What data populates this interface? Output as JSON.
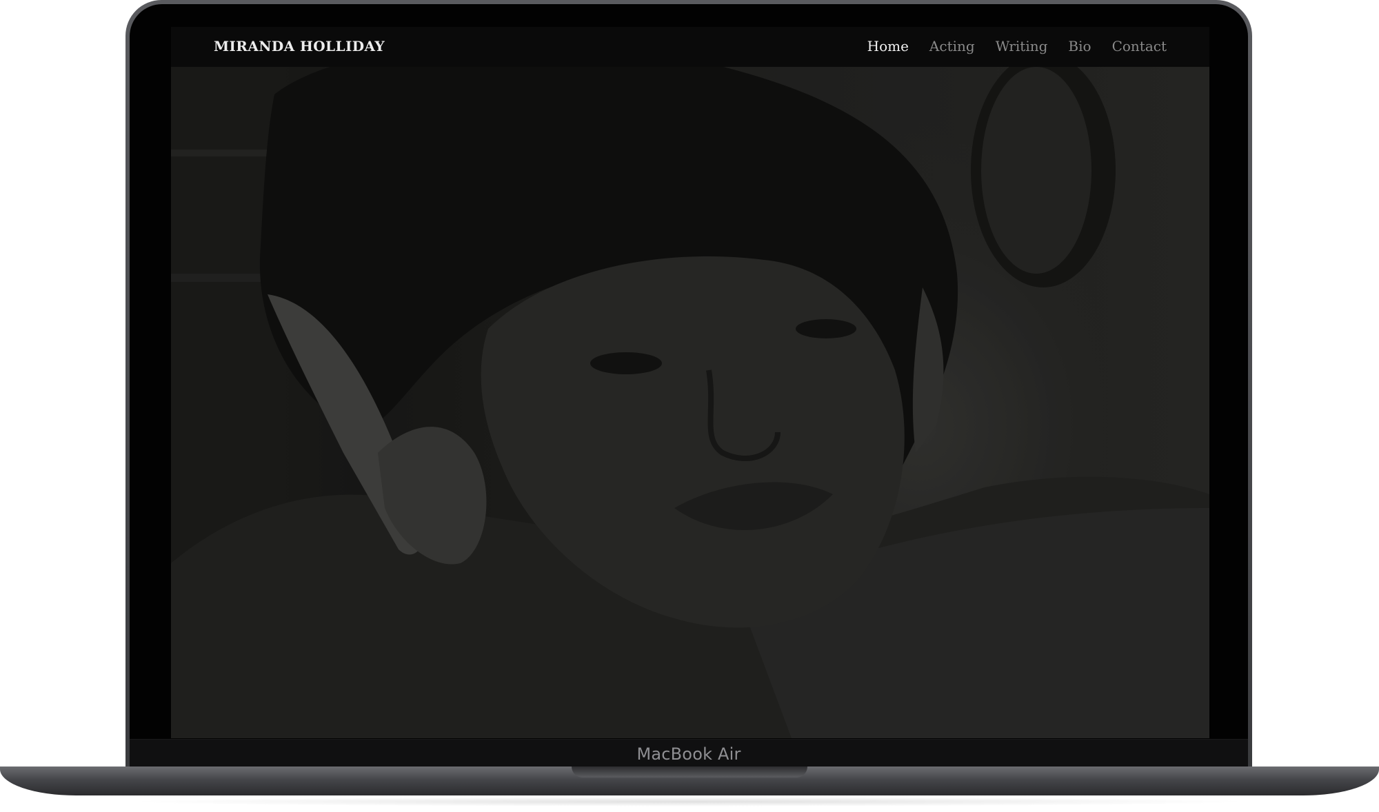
{
  "device": {
    "model_label": "MacBook Air"
  },
  "site": {
    "brand": "MIRANDA HOLLIDAY",
    "nav": [
      {
        "label": "Home",
        "active": true
      },
      {
        "label": "Acting",
        "active": false
      },
      {
        "label": "Writing",
        "active": false
      },
      {
        "label": "Bio",
        "active": false
      },
      {
        "label": "Contact",
        "active": false
      }
    ]
  },
  "colors": {
    "header_bg": "#0a0a0a",
    "nav_active": "#f2f2f2",
    "nav_inactive": "#8a8a8a",
    "hero_tone": "#2b2b29"
  }
}
